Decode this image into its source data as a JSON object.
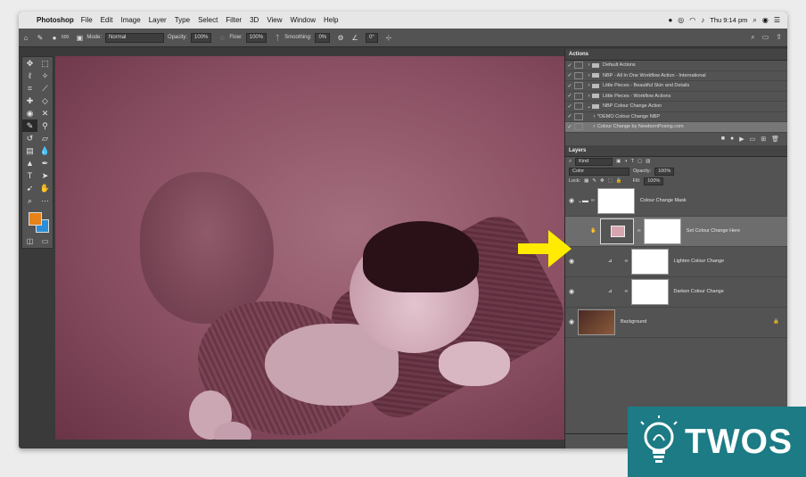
{
  "menubar": {
    "app": "Photoshop",
    "items": [
      "File",
      "Edit",
      "Image",
      "Layer",
      "Type",
      "Select",
      "Filter",
      "3D",
      "View",
      "Window",
      "Help"
    ],
    "clock": "Thu 9:14 pm"
  },
  "options": {
    "brush_size": "600",
    "mode_label": "Mode:",
    "mode_value": "Normal",
    "opacity_label": "Opacity:",
    "opacity_value": "100%",
    "flow_label": "Flow:",
    "flow_value": "100%",
    "smoothing_label": "Smoothing:",
    "smoothing_value": "0%",
    "angle_value": "0°"
  },
  "actions_panel": {
    "title": "Actions",
    "rows": [
      {
        "label": "Default Actions"
      },
      {
        "label": "NBP - All In One Workflow Action - International"
      },
      {
        "label": "Little Pieces - Beautiful Skin and Details"
      },
      {
        "label": "Little Pieces - Workflow Actions"
      },
      {
        "label": "NBP Colour Change Action"
      },
      {
        "label": "*DEMO Colour Change NBP"
      },
      {
        "label": "Colour Change by NewbornPosing.com"
      }
    ]
  },
  "layers_panel": {
    "title": "Layers",
    "kind": "Kind",
    "blend_mode": "Color",
    "opacity_label": "Opacity:",
    "opacity_value": "100%",
    "lock_label": "Lock:",
    "fill_label": "Fill:",
    "fill_value": "100%",
    "layers": [
      {
        "name": "Colour Change Mask"
      },
      {
        "name": "Set Colour Change Here"
      },
      {
        "name": "Lighten Colour Change"
      },
      {
        "name": "Darken Colour Change"
      },
      {
        "name": "Background"
      }
    ]
  },
  "colors": {
    "foreground": "#e8821a",
    "background": "#2c8ed6",
    "arrow": "#ffeb00",
    "watermark_bg": "#1c7b84"
  },
  "watermark": {
    "text": "TWOS"
  }
}
